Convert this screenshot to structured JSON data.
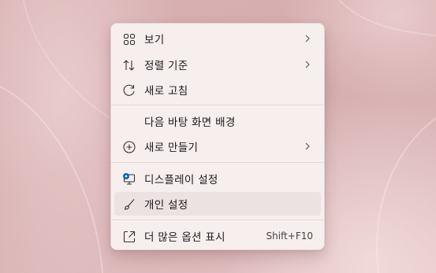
{
  "menu": {
    "items": [
      {
        "label": "보기",
        "icon": "view-grid-icon",
        "submenu": true
      },
      {
        "label": "정렬 기준",
        "icon": "sort-arrows-icon",
        "submenu": true
      },
      {
        "label": "새로 고침",
        "icon": "refresh-icon",
        "submenu": false
      },
      {
        "label": "다음 바탕 화면 배경",
        "icon": "",
        "submenu": false
      },
      {
        "label": "새로 만들기",
        "icon": "new-plus-icon",
        "submenu": true
      },
      {
        "label": "디스플레이 설정",
        "icon": "display-settings-icon",
        "submenu": false
      },
      {
        "label": "개인 설정",
        "icon": "personalize-brush-icon",
        "submenu": false,
        "hovered": true
      },
      {
        "label": "더 많은 옵션 표시",
        "icon": "show-more-options-icon",
        "submenu": false,
        "shortcut": "Shift+F10"
      }
    ]
  },
  "colors": {
    "accent": "#0067c0",
    "menu_bg": "#f7eeee",
    "hover_bg": "#ece2e2"
  }
}
